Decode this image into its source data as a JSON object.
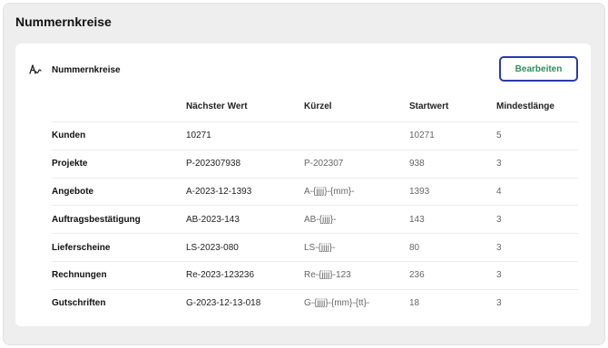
{
  "page": {
    "title": "Nummernkreise"
  },
  "card": {
    "icon": "signature-icon",
    "title": "Nummernkreise",
    "edit_label": "Bearbeiten"
  },
  "table": {
    "headers": [
      "",
      "Nächster Wert",
      "Kürzel",
      "Startwert",
      "Mindestlänge"
    ],
    "rows": [
      [
        "Kunden",
        "10271",
        "",
        "10271",
        "5"
      ],
      [
        "Projekte",
        "P-202307938",
        "P-202307",
        "938",
        "3"
      ],
      [
        "Angebote",
        "A-2023-12-1393",
        "A-{jjjj}-{mm}-",
        "1393",
        "4"
      ],
      [
        "Auftragsbestätigung",
        "AB-2023-143",
        "AB-{jjjj}-",
        "143",
        "3"
      ],
      [
        "Lieferscheine",
        "LS-2023-080",
        "LS-{jjjj}-",
        "80",
        "3"
      ],
      [
        "Rechnungen",
        "Re-2023-123236",
        "Re-{jjjj}-123",
        "236",
        "3"
      ],
      [
        "Gutschriften",
        "G-2023-12-13-018",
        "G-{jjjj}-{mm}-{tt}-",
        "18",
        "3"
      ]
    ]
  },
  "colors": {
    "button_border": "#2c3aa8",
    "button_text": "#2f8f5e",
    "background": "#eeeeee"
  }
}
